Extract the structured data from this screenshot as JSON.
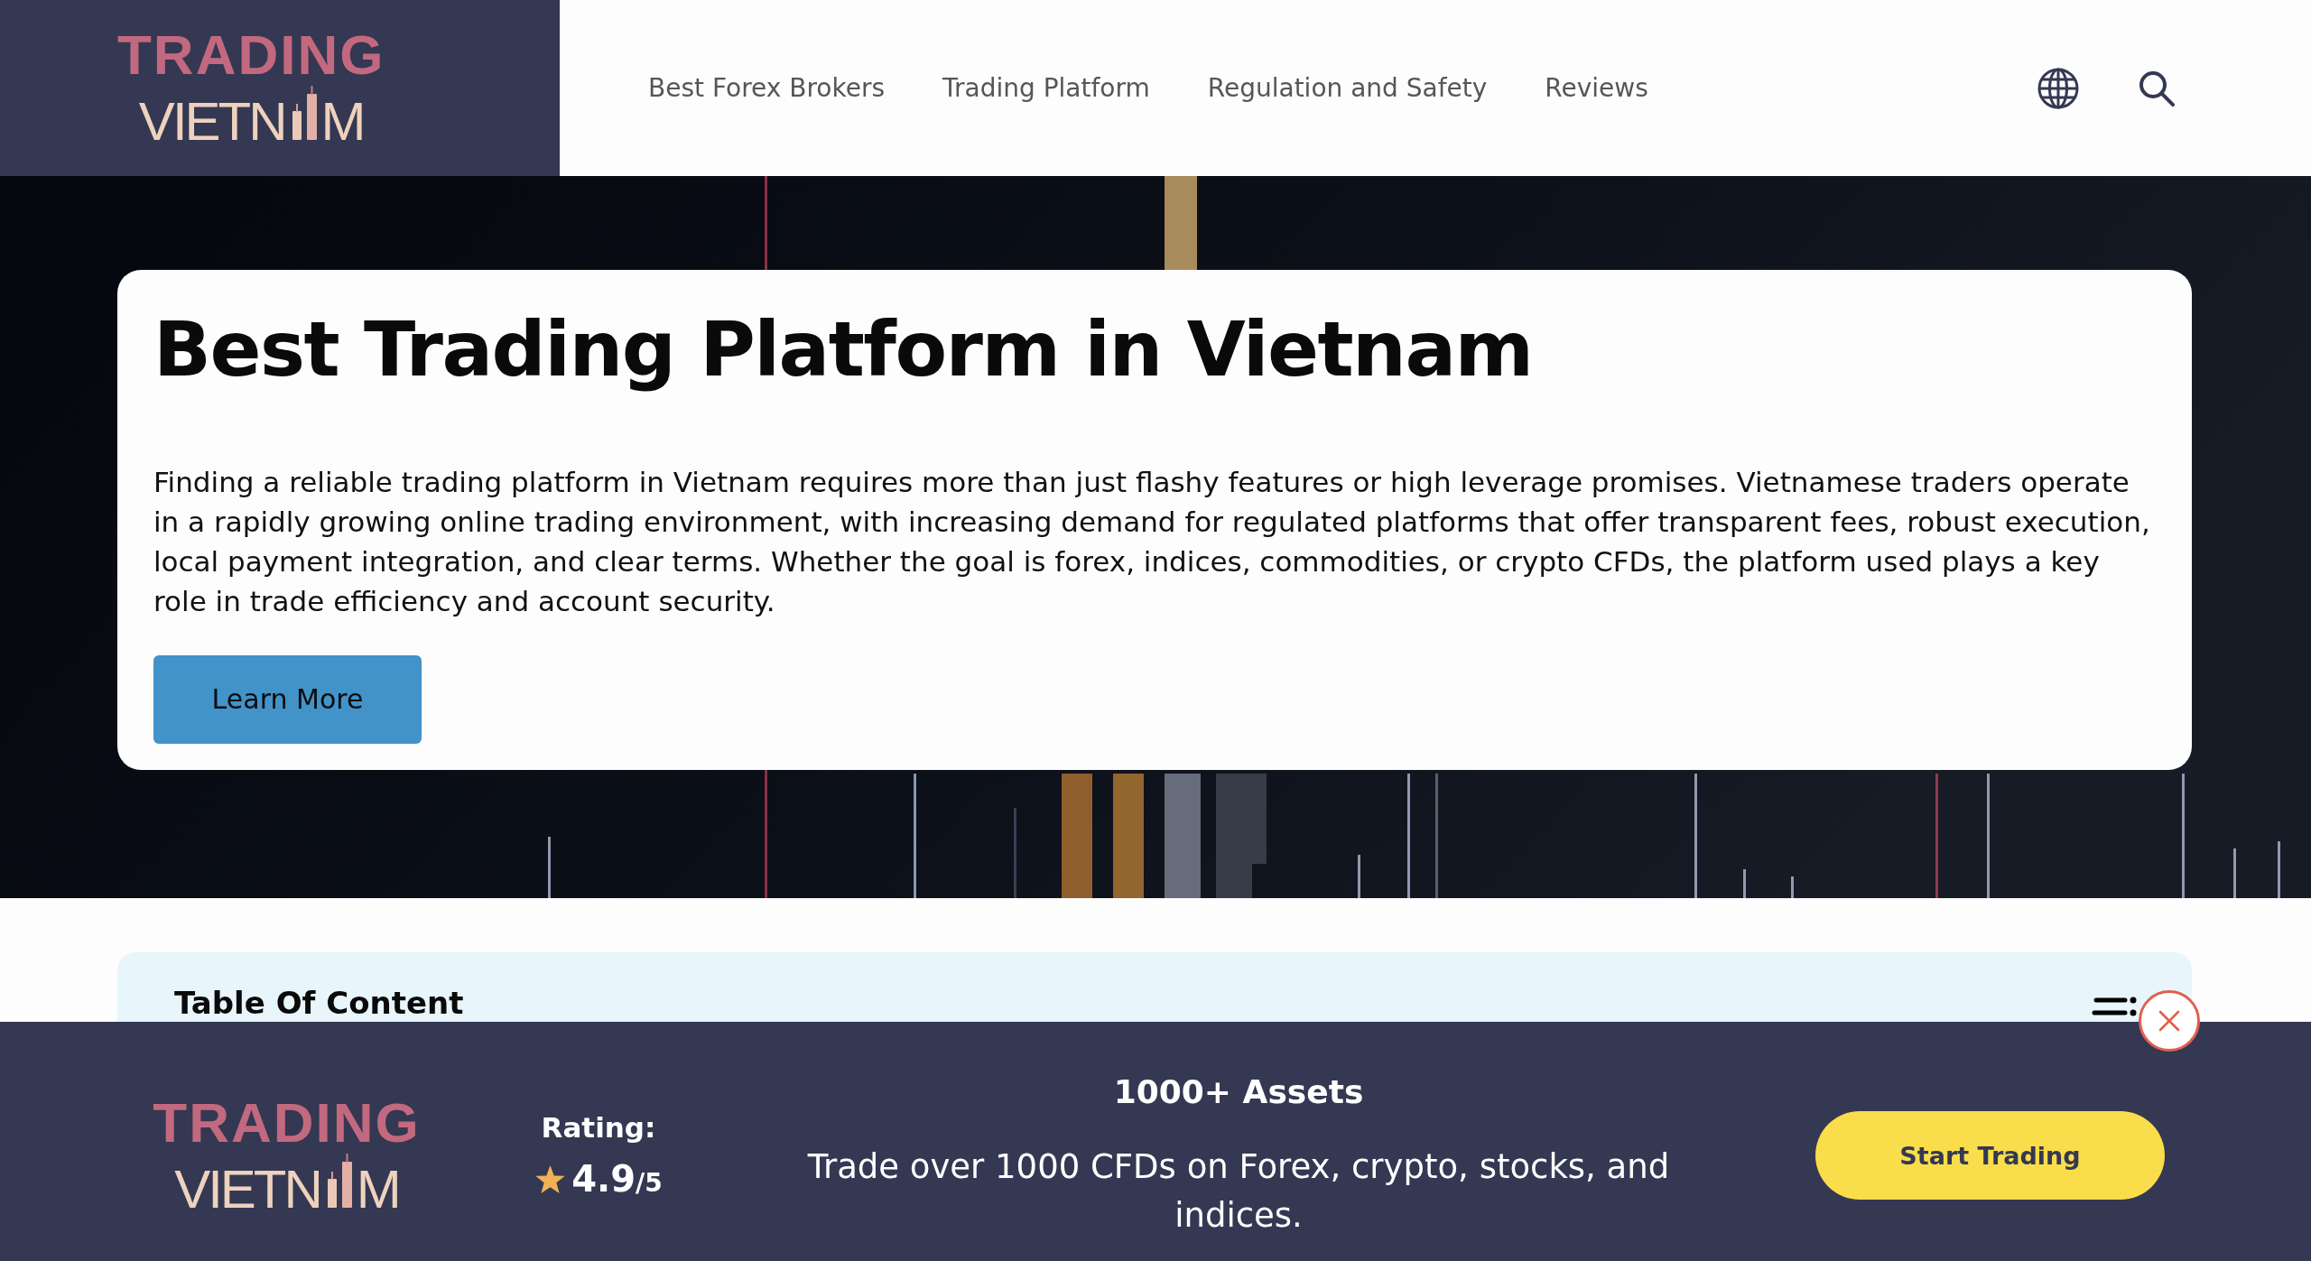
{
  "header": {
    "logo": {
      "line_1": "TRADING",
      "line_2_start": "VIETN",
      "line_2_end": "M"
    },
    "nav": [
      "Best Forex Brokers",
      "Trading Platform",
      "Regulation and Safety",
      "Reviews"
    ]
  },
  "hero": {
    "title": "Best Trading Platform in Vietnam",
    "description": "Finding a reliable trading platform in Vietnam requires more than just flashy features or high leverage promises. Vietnamese traders operate in a rapidly growing online trading environment, with increasing demand for regulated platforms that offer transparent fees, robust execution, local payment integration, and clear terms. Whether the goal is forex, indices, commodities, or crypto CFDs, the platform used plays a key role in trade efficiency and account security.",
    "button": "Learn More"
  },
  "table_of_content": {
    "title": "Table Of Content"
  },
  "sticky_banner": {
    "logo": {
      "line_1": "TRADING",
      "line_2_start": "VIETN",
      "line_2_end": "M"
    },
    "rating": {
      "label": "Rating:",
      "score": "4.9",
      "scale": "/5"
    },
    "headline": "1000+ Assets",
    "text": "Trade over 1000 CFDs on Forex, crypto, stocks, and indices.",
    "button": "Start Trading"
  }
}
